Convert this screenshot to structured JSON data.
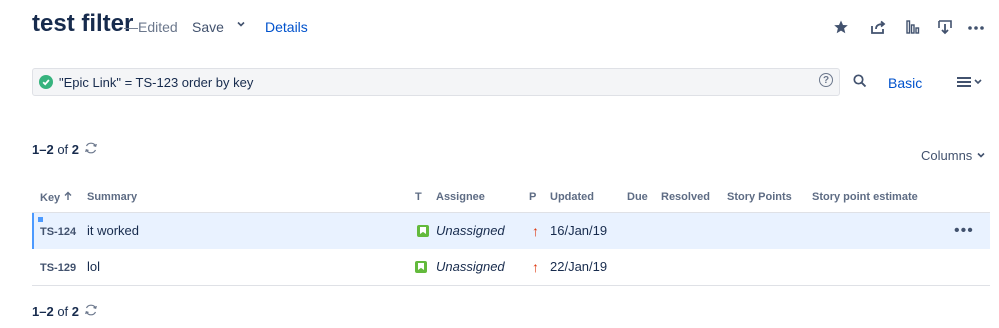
{
  "header": {
    "title": "test filter",
    "dash": "—",
    "status": "Edited",
    "save_label": "Save",
    "details_label": "Details"
  },
  "search": {
    "query": "\"Epic Link\" = TS-123 order by key",
    "basic_label": "Basic"
  },
  "results": {
    "range": "1–2",
    "of_label": "of",
    "total": "2",
    "columns_label": "Columns"
  },
  "table": {
    "headers": [
      "Key",
      "Summary",
      "T",
      "Assignee",
      "P",
      "Updated",
      "Due",
      "Resolved",
      "Story Points",
      "Story point estimate"
    ],
    "rows": [
      {
        "key": "TS-124",
        "summary": "it worked",
        "assignee": "Unassigned",
        "updated": "16/Jan/19"
      },
      {
        "key": "TS-129",
        "summary": "lol",
        "assignee": "Unassigned",
        "updated": "22/Jan/19"
      }
    ]
  },
  "colors": {
    "accent": "#0052cc",
    "success": "#36b37e",
    "story": "#63ba3c",
    "priority_high": "#de350b"
  }
}
